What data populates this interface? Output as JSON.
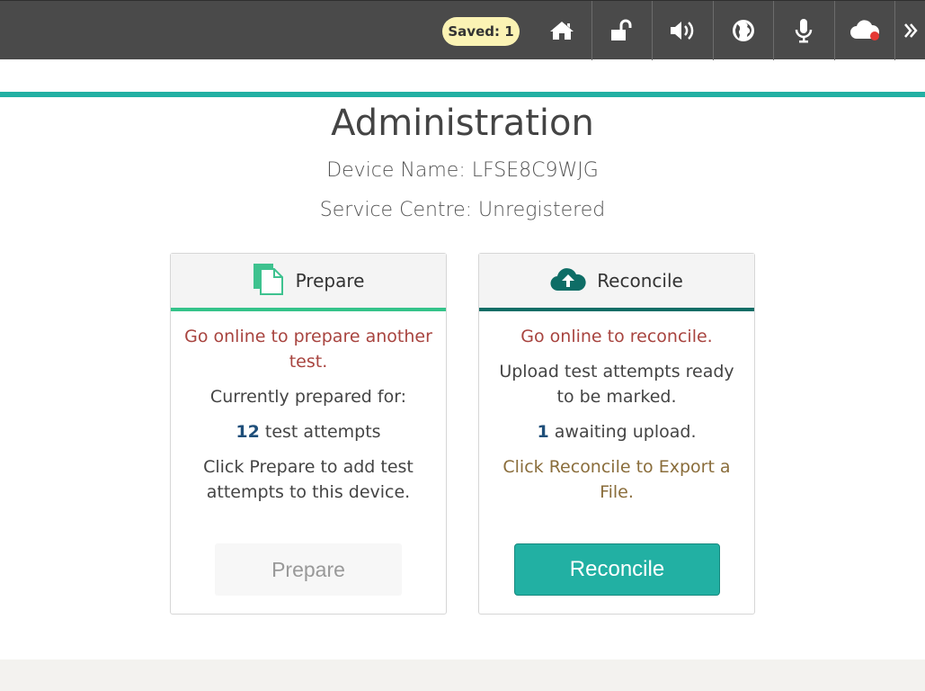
{
  "header": {
    "saved_label": "Saved: 1",
    "buttons": [
      {
        "name": "home-icon"
      },
      {
        "name": "unlock-icon"
      },
      {
        "name": "volume-icon"
      },
      {
        "name": "globe-icon"
      },
      {
        "name": "microphone-icon"
      },
      {
        "name": "cloud-status-icon"
      },
      {
        "name": "chevron-double-right-icon"
      }
    ],
    "bar_color": "#4a4a4a",
    "status_dot_color": "#e53935"
  },
  "page": {
    "title": "Administration",
    "device_name": "Device Name: LFSE8C9WJG",
    "service_centre": "Service Centre: Unregistered",
    "accent_color": "#22b0a3"
  },
  "prepare_card": {
    "title": "Prepare",
    "offline_msg": "Go online to prepare another test.",
    "prepared_for_label": "Currently prepared for:",
    "attempt_count": "12",
    "attempt_suffix": " test attempts",
    "instructions": "Click Prepare to add test attempts to this device.",
    "button_label": "Prepare",
    "accent": "#34c38a"
  },
  "reconcile_card": {
    "title": "Reconcile",
    "offline_msg": "Go online to reconcile.",
    "upload_msg": "Upload test attempts ready to be marked.",
    "awaiting_count": "1",
    "awaiting_suffix": " awaiting upload.",
    "instructions": "Click Reconcile to Export a File.",
    "button_label": "Reconcile",
    "accent": "#0e6d66"
  }
}
